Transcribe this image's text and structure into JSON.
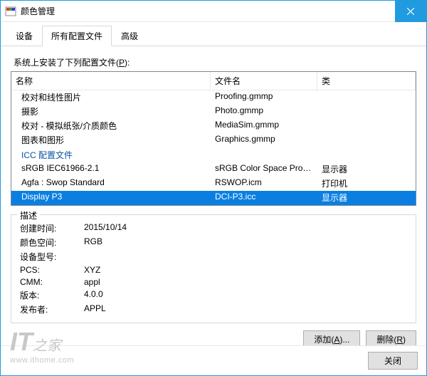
{
  "window": {
    "title": "颜色管理"
  },
  "tabs": {
    "t0": "设备",
    "t1": "所有配置文件",
    "t2": "高级"
  },
  "section_label_pre": "系统上安装了下列配置文件(",
  "section_label_u": "P",
  "section_label_post": "):",
  "columns": {
    "name": "名称",
    "file": "文件名",
    "class": "类"
  },
  "rows_plain": [
    {
      "name": "校对和线性图片",
      "file": "Proofing.gmmp",
      "class": ""
    },
    {
      "name": "摄影",
      "file": "Photo.gmmp",
      "class": ""
    },
    {
      "name": "校对 - 模拟纸张/介质颜色",
      "file": "MediaSim.gmmp",
      "class": ""
    },
    {
      "name": "图表和图形",
      "file": "Graphics.gmmp",
      "class": ""
    }
  ],
  "group_label": "ICC 配置文件",
  "rows_icc": [
    {
      "name": "sRGB IEC61966-2.1",
      "file": "sRGB Color Space Profil...",
      "class": "显示器"
    },
    {
      "name": "Agfa : Swop Standard",
      "file": "RSWOP.icm",
      "class": "打印机"
    },
    {
      "name": "Display P3",
      "file": "DCI-P3.icc",
      "class": "显示器"
    }
  ],
  "selected_index": 2,
  "desc": {
    "title": "描述",
    "labels": {
      "created": "创建时间:",
      "space": "颜色空间:",
      "model": "设备型号:",
      "pcs": "PCS:",
      "cmm": "CMM:",
      "ver": "版本:",
      "publisher": "发布者:"
    },
    "values": {
      "created": "2015/10/14",
      "space": "RGB",
      "model": "",
      "pcs": "XYZ",
      "cmm": "appl",
      "ver": "4.0.0",
      "publisher": "APPL"
    }
  },
  "buttons": {
    "add_pre": "添加(",
    "add_u": "A",
    "add_post": ")...",
    "remove_pre": "删除(",
    "remove_u": "R",
    "remove_post": ")",
    "close": "关闭"
  },
  "watermark": {
    "big": "IT",
    "suffix": "之家",
    "url": "www.ithome.com"
  }
}
